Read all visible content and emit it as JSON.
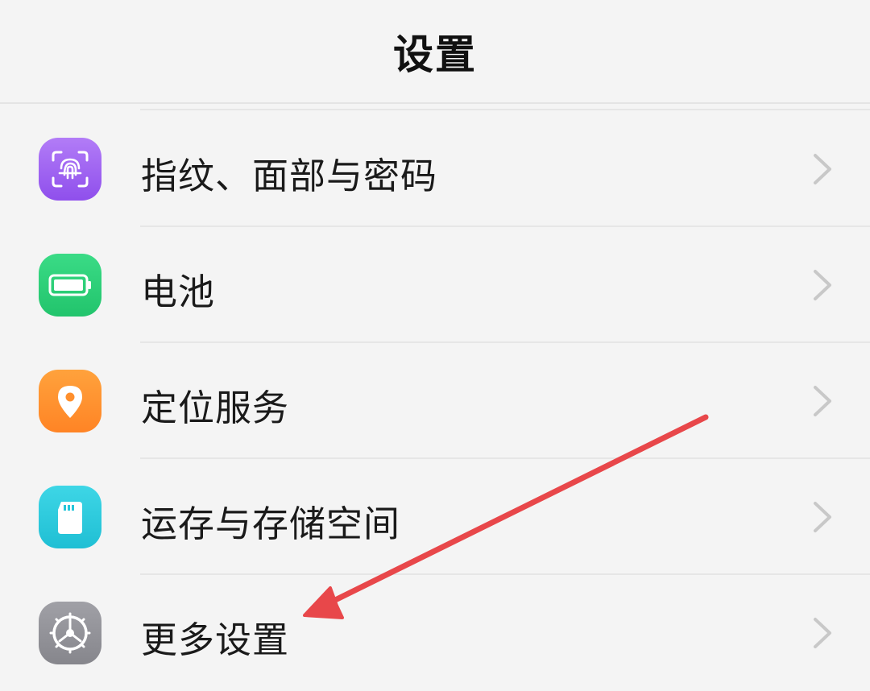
{
  "header": {
    "title": "设置"
  },
  "items": [
    {
      "label": "指纹、面部与密码",
      "icon": "fingerprint-icon",
      "color": "#9a5cf0"
    },
    {
      "label": "电池",
      "icon": "battery-icon",
      "color": "#2fcf7a"
    },
    {
      "label": "定位服务",
      "icon": "location-pin-icon",
      "color": "#ff8f2c"
    },
    {
      "label": "运存与存储空间",
      "icon": "sd-card-icon",
      "color": "#26c6da"
    },
    {
      "label": "更多设置",
      "icon": "gear-icon",
      "color": "#8e8e93"
    }
  ],
  "annotation": {
    "color": "#e8474a",
    "points_to": "更多设置"
  }
}
